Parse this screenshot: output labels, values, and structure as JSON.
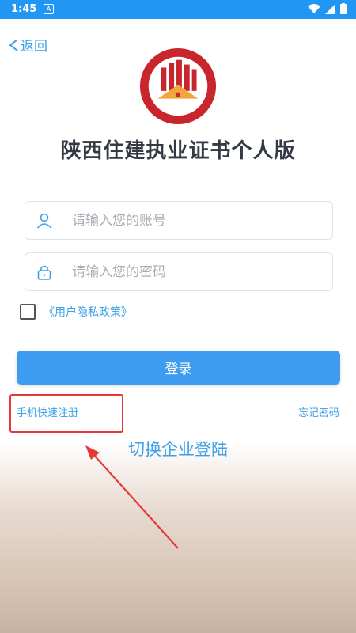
{
  "status": {
    "time": "1:45",
    "notif_icon": "A"
  },
  "nav": {
    "back_label": "返回"
  },
  "app": {
    "title": "陕西住建执业证书个人版"
  },
  "form": {
    "account_placeholder": "请输入您的账号",
    "password_placeholder": "请输入您的密码",
    "privacy_policy": "《用户隐私政策》",
    "login_label": "登录"
  },
  "links": {
    "quick_register": "手机快速注册",
    "forgot_password": "忘记密码",
    "switch_enterprise": "切换企业登陆"
  },
  "colors": {
    "accent": "#3d9cf0",
    "status_bar": "#2196f3",
    "highlight": "#e53935"
  }
}
